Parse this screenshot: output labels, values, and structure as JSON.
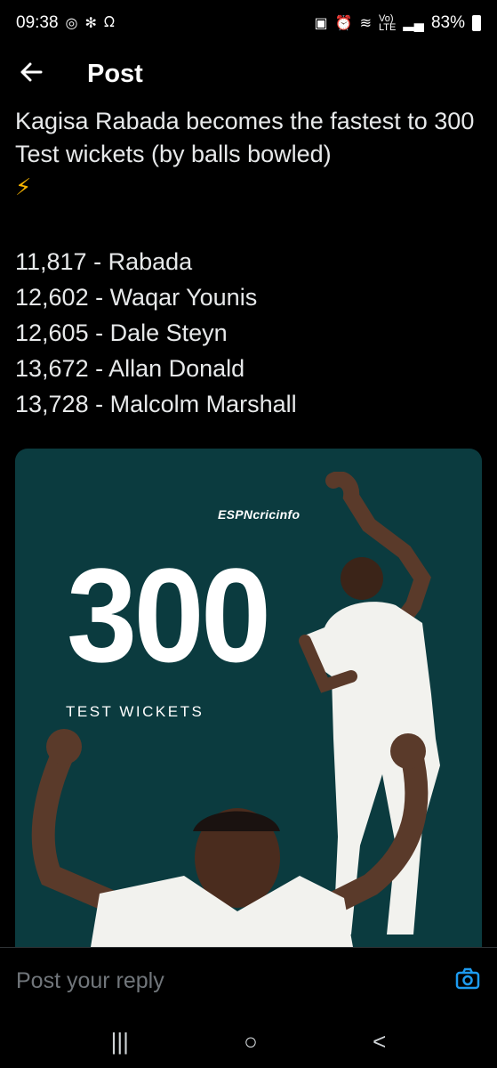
{
  "status_bar": {
    "time": "09:38",
    "battery": "83%",
    "left_icons": [
      "whatsapp-icon",
      "flower-icon",
      "ribbon-icon"
    ],
    "right_icons": [
      "screen-lock-icon",
      "alarm-icon",
      "wifi-icon",
      "volte-icon",
      "signal-icon",
      "battery-icon"
    ]
  },
  "header": {
    "back_icon": "arrow-left-icon",
    "title": "Post"
  },
  "post": {
    "headline": "Kagisa Rabada becomes the fastest to 300 Test wickets (by balls bowled)",
    "emoji": "⚡",
    "list": [
      "11,817 - Rabada",
      "12,602 - Waqar Younis",
      "12,605 - Dale Steyn",
      "13,672 - Allan Donald",
      "13,728 - Malcolm Marshall"
    ]
  },
  "image": {
    "brand": "ESPNcricinfo",
    "number": "300",
    "caption": "TEST WICKETS",
    "background": "#0b3b3f"
  },
  "reply": {
    "placeholder": "Post your reply",
    "camera_icon": "camera-icon",
    "accent": "#1d9bf0"
  },
  "nav_bar": {
    "icons": [
      "recents-icon",
      "home-icon",
      "back-icon"
    ],
    "recents": "|||",
    "home": "○",
    "back": "<"
  }
}
